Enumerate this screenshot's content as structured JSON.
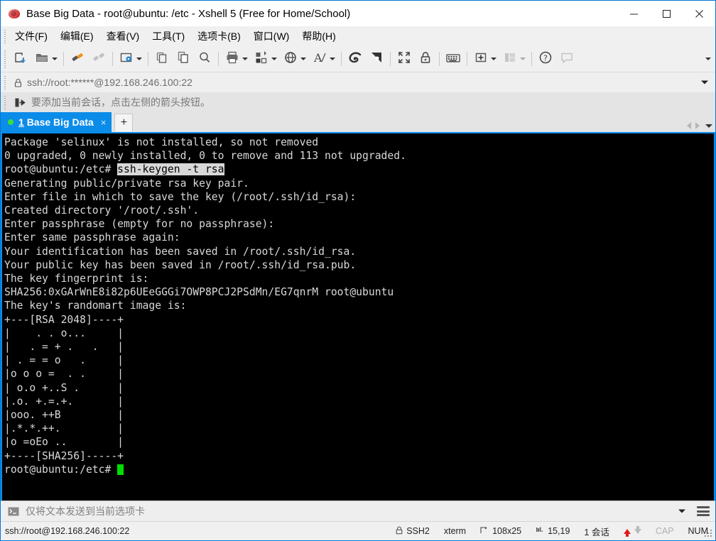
{
  "window": {
    "title": "Base Big Data - root@ubuntu: /etc - Xshell 5 (Free for Home/School)",
    "minimize_label": "—",
    "maximize_label": "□",
    "close_label": "✕"
  },
  "menubar": {
    "items": [
      {
        "label": "文件(F)",
        "name": "menu-file"
      },
      {
        "label": "编辑(E)",
        "name": "menu-edit"
      },
      {
        "label": "查看(V)",
        "name": "menu-view"
      },
      {
        "label": "工具(T)",
        "name": "menu-tools"
      },
      {
        "label": "选项卡(B)",
        "name": "menu-tabs"
      },
      {
        "label": "窗口(W)",
        "name": "menu-window"
      },
      {
        "label": "帮助(H)",
        "name": "menu-help"
      }
    ]
  },
  "toolbar": {
    "icons": [
      "new-session-icon",
      "open-folder-icon",
      "connect-icon",
      "disconnect-icon",
      "session-properties-icon",
      "copy-session-icon",
      "paste-icon",
      "find-icon",
      "print-icon",
      "transfer-file-icon",
      "globe-icon",
      "font-icon",
      "xshell-icon",
      "xftp-icon",
      "fullscreen-icon",
      "lock-icon",
      "keyboard-icon",
      "add-to-folder-icon",
      "layout-icon",
      "help-icon",
      "comment-icon"
    ],
    "overflow_label": "▼"
  },
  "address_bar": {
    "lock_icon": "lock-icon",
    "value": "ssh://root:******@192.168.246.100:22",
    "dropdown_label": "▼"
  },
  "hint_bar": {
    "icon": "add-session-arrow-icon",
    "text": "要添加当前会话，点击左侧的箭头按钮。"
  },
  "tabs": {
    "items": [
      {
        "index": "1",
        "label": "Base Big Data",
        "active": true,
        "status": "connected",
        "close_label": "×"
      }
    ],
    "new_tab_label": "+",
    "nav_prev_label": "◀",
    "nav_next_label": "▶",
    "nav_menu_label": "▼"
  },
  "terminal": {
    "lines": [
      {
        "text": "Package 'selinux' is not installed, so not removed"
      },
      {
        "text": "0 upgraded, 0 newly installed, 0 to remove and 113 not upgraded."
      },
      {
        "prompt": "root@ubuntu:/etc# ",
        "selected": "ssh-keygen -t rsa"
      },
      {
        "text": "Generating public/private rsa key pair."
      },
      {
        "text": "Enter file in which to save the key (/root/.ssh/id_rsa):"
      },
      {
        "text": "Created directory '/root/.ssh'."
      },
      {
        "text": "Enter passphrase (empty for no passphrase):"
      },
      {
        "text": "Enter same passphrase again:"
      },
      {
        "text": "Your identification has been saved in /root/.ssh/id_rsa."
      },
      {
        "text": "Your public key has been saved in /root/.ssh/id_rsa.pub."
      },
      {
        "text": "The key fingerprint is:"
      },
      {
        "text": "SHA256:0xGArWnE8i82p6UEeGGGi7OWP8PCJ2PSdMn/EG7qnrM root@ubuntu"
      },
      {
        "text": "The key's randomart image is:"
      },
      {
        "text": "+---[RSA 2048]----+"
      },
      {
        "text": "|    . . o...     |"
      },
      {
        "text": "|   . = + .   .   |"
      },
      {
        "text": "| . = = o   .     |"
      },
      {
        "text": "|o o o =  . .     |"
      },
      {
        "text": "| o.o +..S .      |"
      },
      {
        "text": "|.o. +.=.+.       |"
      },
      {
        "text": "|ooo. ++B         |"
      },
      {
        "text": "|.*.*.++.         |"
      },
      {
        "text": "|o =oEo ..        |"
      },
      {
        "text": "+----[SHA256]-----+"
      },
      {
        "prompt": "root@ubuntu:/etc# ",
        "cursor": true
      }
    ],
    "selection_bg": "#d8d8d8",
    "selection_fg": "#000000",
    "background": "#000000",
    "foreground": "#d8d8d8",
    "cursor_color": "#00dd00"
  },
  "send_bar": {
    "icon": "terminal-prompt-icon",
    "text": "仅将文本发送到当前选项卡",
    "dropdown_label": "▼",
    "menu_icon": "list-lines-icon"
  },
  "status_bar": {
    "connection": "ssh://root@192.168.246.100:22",
    "protocol": "SSH2",
    "protocol_icon": "lock-icon",
    "terminal_type": "xterm",
    "size": "108x25",
    "size_icon": "resize-icon",
    "cursor_position": "15,19",
    "cursor_icon": "cursor-position-icon",
    "sessions": "1 会话",
    "upload_indicator": "upload-arrow-icon",
    "download_indicator": "download-arrow-icon",
    "caps_lock": "CAP",
    "num_lock": "NUM"
  },
  "colors": {
    "accent": "#0c8ce9",
    "title_border": "#0078d7",
    "chrome": "#f0f0f0",
    "terminal_green": "#00dd00",
    "status_red": "#e01b1b"
  }
}
